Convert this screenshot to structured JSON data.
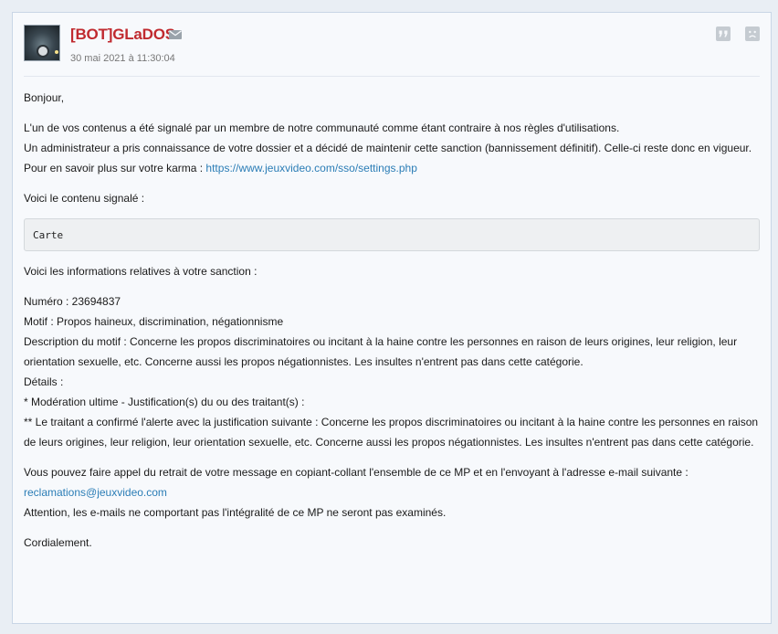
{
  "post": {
    "author": "[BOT]GLaDOS",
    "date": "30 mai 2021 à 11:30:04",
    "icons": {
      "avatar": "glados-avatar",
      "mail": "mail-icon",
      "quote": "quote-icon",
      "report": "sad-face-icon"
    },
    "greeting": "Bonjour,",
    "para1_line1": "L'un de vos contenus a été signalé par un membre de notre communauté comme étant contraire à nos règles d'utilisations.",
    "para1_line2": "Un administrateur a pris connaissance de votre dossier et a décidé de maintenir cette sanction (bannissement définitif). Celle-ci reste donc en vigueur.",
    "para1_line3_prefix": "Pour en savoir plus sur votre karma : ",
    "karma_link": "https://www.jeuxvideo.com/sso/settings.php",
    "reported_intro": "Voici le contenu signalé :",
    "reported_content": "Carte",
    "sanction_intro": "Voici les informations relatives à votre sanction :",
    "numero": "Numéro : 23694837",
    "motif": "Motif : Propos haineux, discrimination, négationnisme",
    "description": "Description du motif : Concerne les propos discriminatoires ou incitant à la haine contre les personnes en raison de leurs origines, leur religion, leur orientation sexuelle, etc. Concerne aussi les propos négationnistes. Les insultes n'entrent pas dans cette catégorie.",
    "details": "Détails :",
    "moderation": "* Modération ultime - Justification(s) du ou des traitant(s) :",
    "traitant": "** Le traitant a confirmé l'alerte avec la justification suivante : Concerne les propos discriminatoires ou incitant à la haine contre les personnes en raison de leurs origines, leur religion, leur orientation sexuelle, etc. Concerne aussi les propos négationnistes. Les insultes n'entrent pas dans cette catégorie.",
    "appeal": "Vous pouvez faire appel du retrait de votre message en copiant-collant l'ensemble de ce MP et en l'envoyant à l'adresse e-mail suivante :",
    "appeal_email": "reclamations@jeuxvideo.com",
    "warning": "Attention, les e-mails ne comportant pas l'intégralité de ce MP ne seront pas examinés.",
    "closing": "Cordialement."
  }
}
